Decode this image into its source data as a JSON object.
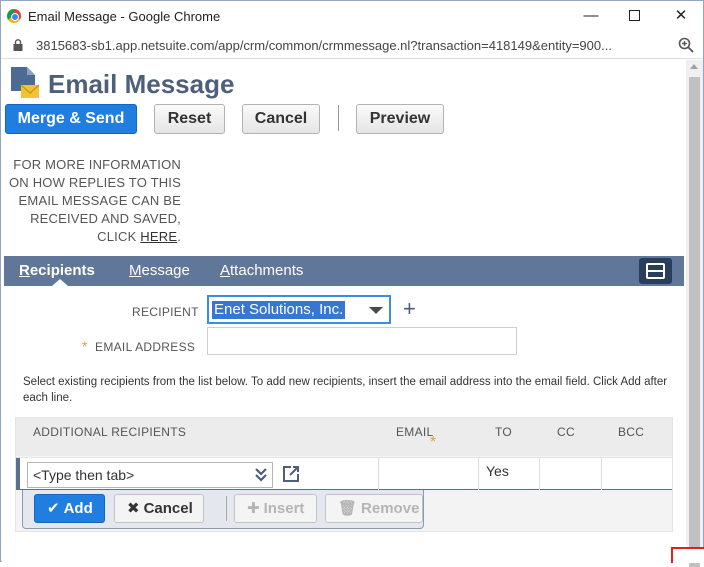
{
  "window": {
    "title": "Email Message - Google Chrome",
    "min_glyph": "—",
    "close_glyph": "✕"
  },
  "address": {
    "url": "3815683-sb1.app.netsuite.com/app/crm/common/crmmessage.nl?transaction=418149&entity=900..."
  },
  "page": {
    "title": "Email Message"
  },
  "toolbar": {
    "merge_send": "Merge & Send",
    "reset": "Reset",
    "cancel": "Cancel",
    "preview": "Preview"
  },
  "info": {
    "line1": "FOR MORE INFORMATION",
    "line2": "ON HOW REPLIES TO THIS",
    "line3": "EMAIL MESSAGE CAN BE",
    "line4": "RECEIVED AND SAVED,",
    "line5_prefix": "CLICK ",
    "link": "HERE",
    "line5_suffix": "."
  },
  "tabs": [
    {
      "first": "R",
      "rest": "ecipients",
      "active": true
    },
    {
      "first": "M",
      "rest": "essage",
      "active": false
    },
    {
      "first": "A",
      "rest": "ttachments",
      "active": false
    }
  ],
  "form": {
    "recipient_label": "RECIPIENT",
    "recipient_value": "Enet Solutions, Inc.",
    "email_label": "EMAIL ADDRESS",
    "email_value": "",
    "required_star": "*"
  },
  "help": {
    "text": "Select existing recipients from the list below. To add new recipients, insert the email address into the email field. Click Add after each line."
  },
  "grid": {
    "columns": {
      "additional": "ADDITIONAL RECIPIENTS",
      "email": "EMAIL",
      "to": "TO",
      "cc": "CC",
      "bcc": "BCC"
    },
    "row": {
      "recipient_placeholder": "<Type then tab>",
      "email": "",
      "to": "Yes",
      "cc": "",
      "bcc": ""
    },
    "buttons": {
      "add": "Add",
      "cancel": "Cancel",
      "insert": "Insert",
      "remove": "Remove"
    }
  },
  "colors": {
    "accent_blue": "#1f7ee0",
    "tab_bar": "#607799",
    "title_text": "#4d5f79",
    "required_star": "#e3a33b"
  },
  "icons": [
    "chrome-logo-icon",
    "lock-icon",
    "zoom-icon",
    "email-page-icon",
    "plus-icon",
    "hamburger-menu-icon",
    "double-chevron-icon",
    "external-link-icon",
    "check-icon",
    "x-icon",
    "plus-icon",
    "trash-icon"
  ]
}
